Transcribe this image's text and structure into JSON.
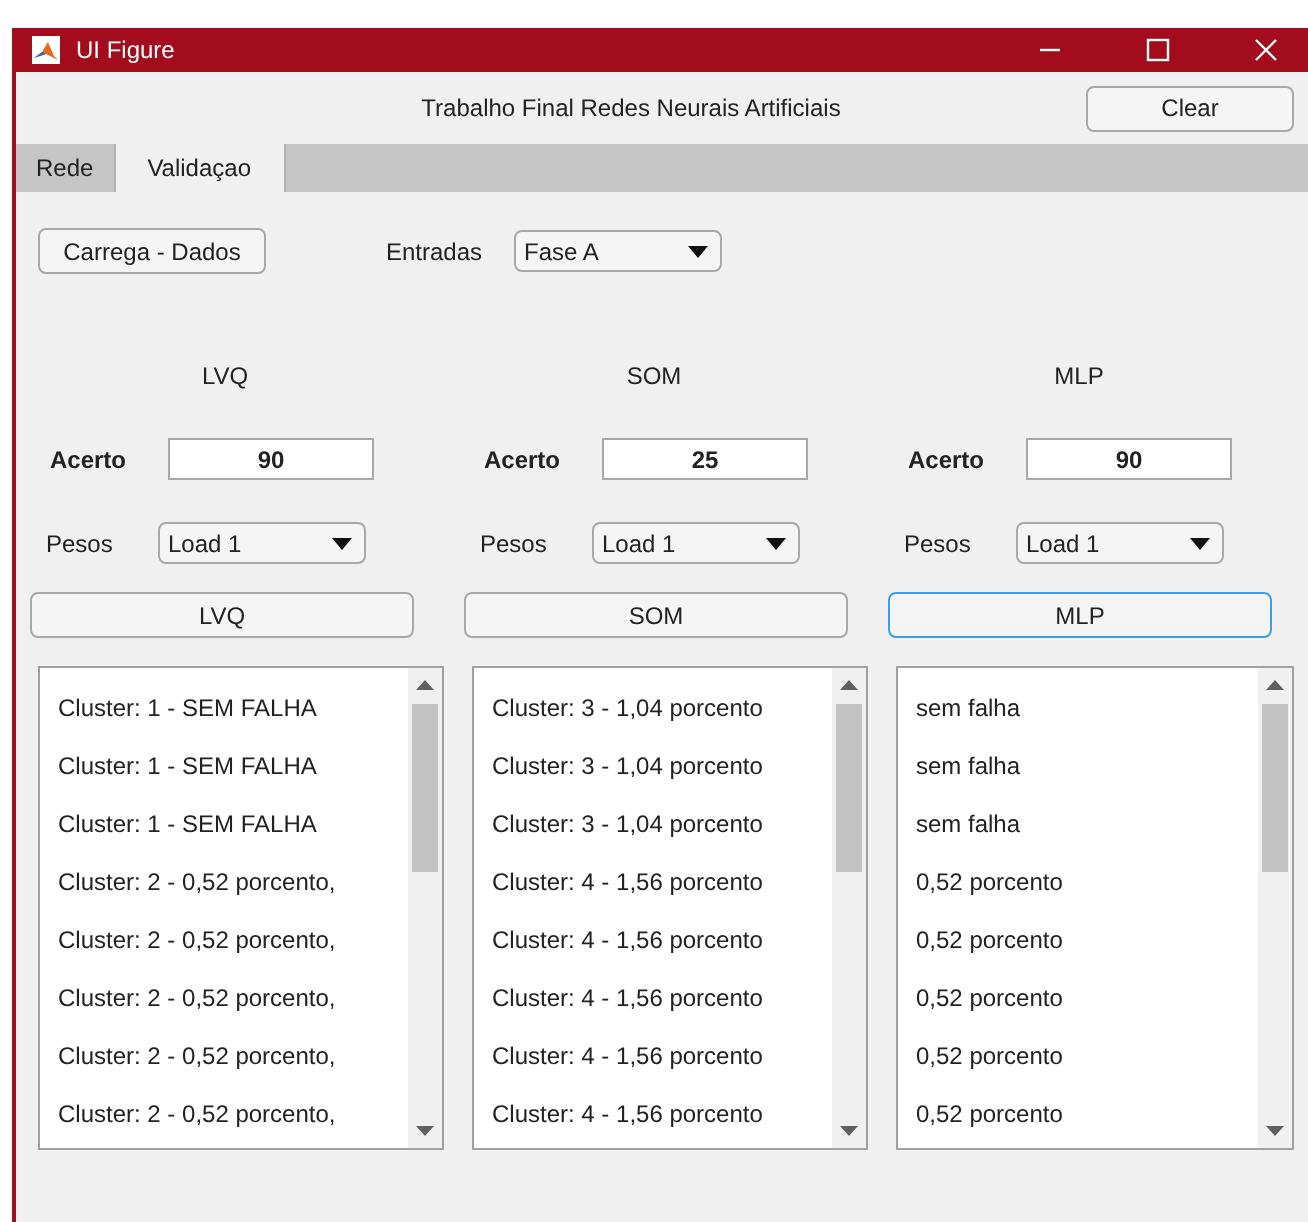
{
  "window": {
    "title": "UI Figure"
  },
  "header": {
    "title": "Trabalho Final Redes Neurais Artificiais",
    "clear_button": "Clear"
  },
  "tabs": [
    {
      "label": "Rede",
      "selected": false
    },
    {
      "label": "Validaçao",
      "selected": true
    }
  ],
  "inputs": {
    "load_button": "Carrega - Dados",
    "label": "Entradas",
    "value": "Fase A"
  },
  "networks": [
    {
      "title": "LVQ",
      "acerto_label": "Acerto",
      "acerto_value": "90",
      "pesos_label": "Pesos",
      "pesos_value": "Load 1",
      "button": "LVQ",
      "focused": false,
      "items": [
        "Cluster: 1 - SEM FALHA",
        "Cluster: 1 - SEM FALHA",
        "Cluster: 1 - SEM FALHA",
        "Cluster: 2 - 0,52 porcento,",
        "Cluster: 2 - 0,52 porcento,",
        "Cluster: 2 - 0,52 porcento,",
        "Cluster: 2 - 0,52 porcento,",
        "Cluster: 2 - 0,52 porcento,"
      ]
    },
    {
      "title": "SOM",
      "acerto_label": "Acerto",
      "acerto_value": "25",
      "pesos_label": "Pesos",
      "pesos_value": "Load 1",
      "button": "SOM",
      "focused": false,
      "items": [
        "Cluster: 3 - 1,04 porcento",
        "Cluster: 3 - 1,04 porcento",
        "Cluster: 3 - 1,04 porcento",
        "Cluster: 4 - 1,56 porcento",
        "Cluster: 4 - 1,56 porcento",
        "Cluster: 4 - 1,56 porcento",
        "Cluster: 4 - 1,56 porcento",
        "Cluster: 4 - 1,56 porcento"
      ]
    },
    {
      "title": "MLP",
      "acerto_label": "Acerto",
      "acerto_value": "90",
      "pesos_label": "Pesos",
      "pesos_value": "Load 1",
      "button": "MLP",
      "focused": true,
      "items": [
        "sem falha",
        "sem falha",
        "sem falha",
        "0,52 porcento",
        "0,52 porcento",
        "0,52 porcento",
        "0,52 porcento",
        "0,52 porcento"
      ]
    }
  ]
}
